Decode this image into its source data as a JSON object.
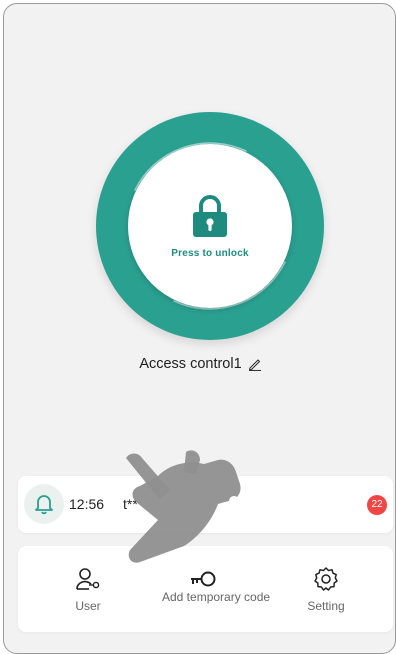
{
  "colors": {
    "accent": "#2aa091",
    "accent_dark": "#1e8b7e",
    "badge": "#f04646",
    "background": "#f2f2f2",
    "card": "#ffffff"
  },
  "unlock": {
    "label": "Press to unlock",
    "icon": "lock-icon"
  },
  "device": {
    "name": "Access control1",
    "edit_icon": "pencil-icon"
  },
  "notification": {
    "icon": "bell-icon",
    "time": "12:56",
    "text": "t**",
    "badge_count": "22"
  },
  "actions": [
    {
      "label": "User",
      "icon": "user-key-icon"
    },
    {
      "label": "Add temporary code",
      "icon": "key-icon"
    },
    {
      "label": "Setting",
      "icon": "gear-icon"
    }
  ],
  "overlay": {
    "icon": "pointing-hand-icon"
  }
}
